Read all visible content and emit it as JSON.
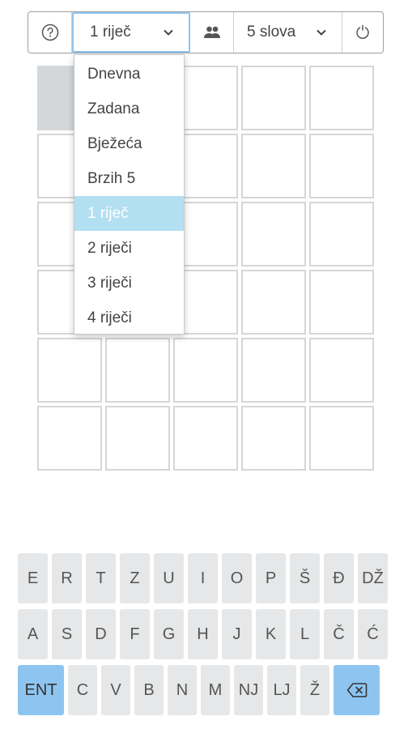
{
  "toolbar": {
    "help_icon": "question-circle-icon",
    "mode_selected": "1 riječ",
    "people_icon": "people-icon",
    "letters_selected": "5 slova",
    "reset_icon": "refresh-icon"
  },
  "dropdown": {
    "options": [
      "Dnevna",
      "Zadana",
      "Bježeća",
      "Brzih 5",
      "1 riječ",
      "2 riječi",
      "3 riječi",
      "4 riječi"
    ],
    "selected": "1 riječ"
  },
  "board": {
    "rows": 6,
    "cols": 5,
    "active_cell": "row 1, column 1"
  },
  "keyboard": {
    "row1": [
      "E",
      "R",
      "T",
      "Z",
      "U",
      "I",
      "O",
      "P",
      "Š",
      "Đ",
      "DŽ"
    ],
    "row2": [
      "A",
      "S",
      "D",
      "F",
      "G",
      "H",
      "J",
      "K",
      "L",
      "Č",
      "Ć"
    ],
    "row3": [
      "ENT",
      "C",
      "V",
      "B",
      "N",
      "M",
      "NJ",
      "LJ",
      "Ž"
    ],
    "backspace_icon": "backspace-icon",
    "accent_color": "#8ec5f0"
  },
  "colors": {
    "selected_option_bg": "#b3dff2",
    "active_cell": "#d4d7da",
    "key_bg": "#e6e7e8"
  }
}
